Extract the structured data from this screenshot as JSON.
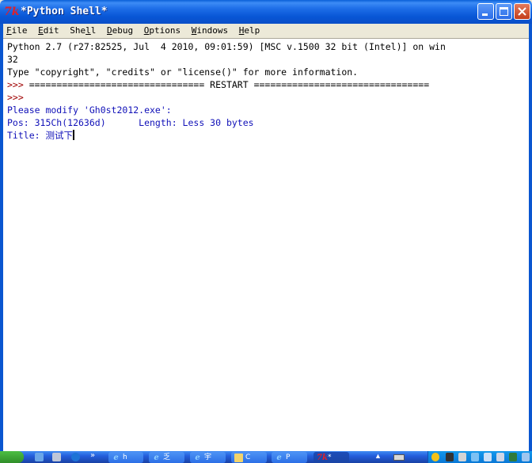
{
  "window": {
    "title": "*Python Shell*",
    "app_icon_glyph": "7k",
    "controls": [
      "minimize",
      "maximize",
      "close"
    ]
  },
  "menubar": {
    "items": [
      {
        "ul": "F",
        "rest": "ile"
      },
      {
        "ul": "E",
        "rest": "dit"
      },
      {
        "ul": "",
        "pre": "She",
        "ul2": "l",
        "rest": "l"
      },
      {
        "ul": "D",
        "rest": "ebug"
      },
      {
        "ul": "O",
        "rest": "ptions"
      },
      {
        "ul": "W",
        "rest": "indows"
      },
      {
        "ul": "H",
        "rest": "elp"
      }
    ]
  },
  "shell": {
    "lines": [
      {
        "text": "Python 2.7 (r27:82525, Jul  4 2010, 09:01:59) [MSC v.1500 32 bit (Intel)] on win",
        "style": "black"
      },
      {
        "text": "32",
        "style": "black"
      },
      {
        "text": "Type \"copyright\", \"credits\" or \"license()\" for more information.",
        "style": "black"
      },
      {
        "prompt": ">>> ",
        "text": "================================ RESTART ================================",
        "style": "black"
      },
      {
        "prompt": ">>> ",
        "text": "",
        "style": "black"
      },
      {
        "text": "Please modify 'Gh0st2012.exe':",
        "style": "blue"
      },
      {
        "text": "Pos: 315Ch(12636d)      Length: Less 30 bytes",
        "style": "blue"
      },
      {
        "text": "Title: 测试下",
        "style": "blue",
        "cursor": true
      }
    ]
  },
  "taskbar": {
    "quick_launch": [
      "show-desktop-icon",
      "media-player-icon",
      "internet-explorer-icon"
    ],
    "overflow": "»",
    "tasks": [
      {
        "label": "h",
        "icon": "ie-icon"
      },
      {
        "label": "乏",
        "icon": "ie-icon"
      },
      {
        "label": "宇",
        "icon": "ie-icon"
      },
      {
        "label": "C",
        "icon": "folder-icon"
      },
      {
        "label": "P",
        "icon": "ie-icon"
      },
      {
        "label": "*",
        "icon": "python-idle-icon",
        "active": true
      }
    ],
    "tray_icons": [
      "qq-icon",
      "antivirus-icon",
      "network-icon",
      "security-icon",
      "volume-icon"
    ]
  },
  "colors": {
    "titlebar": "#0a56d6",
    "prompt": "#a00000",
    "output": "#1010b8",
    "text": "#000000"
  }
}
